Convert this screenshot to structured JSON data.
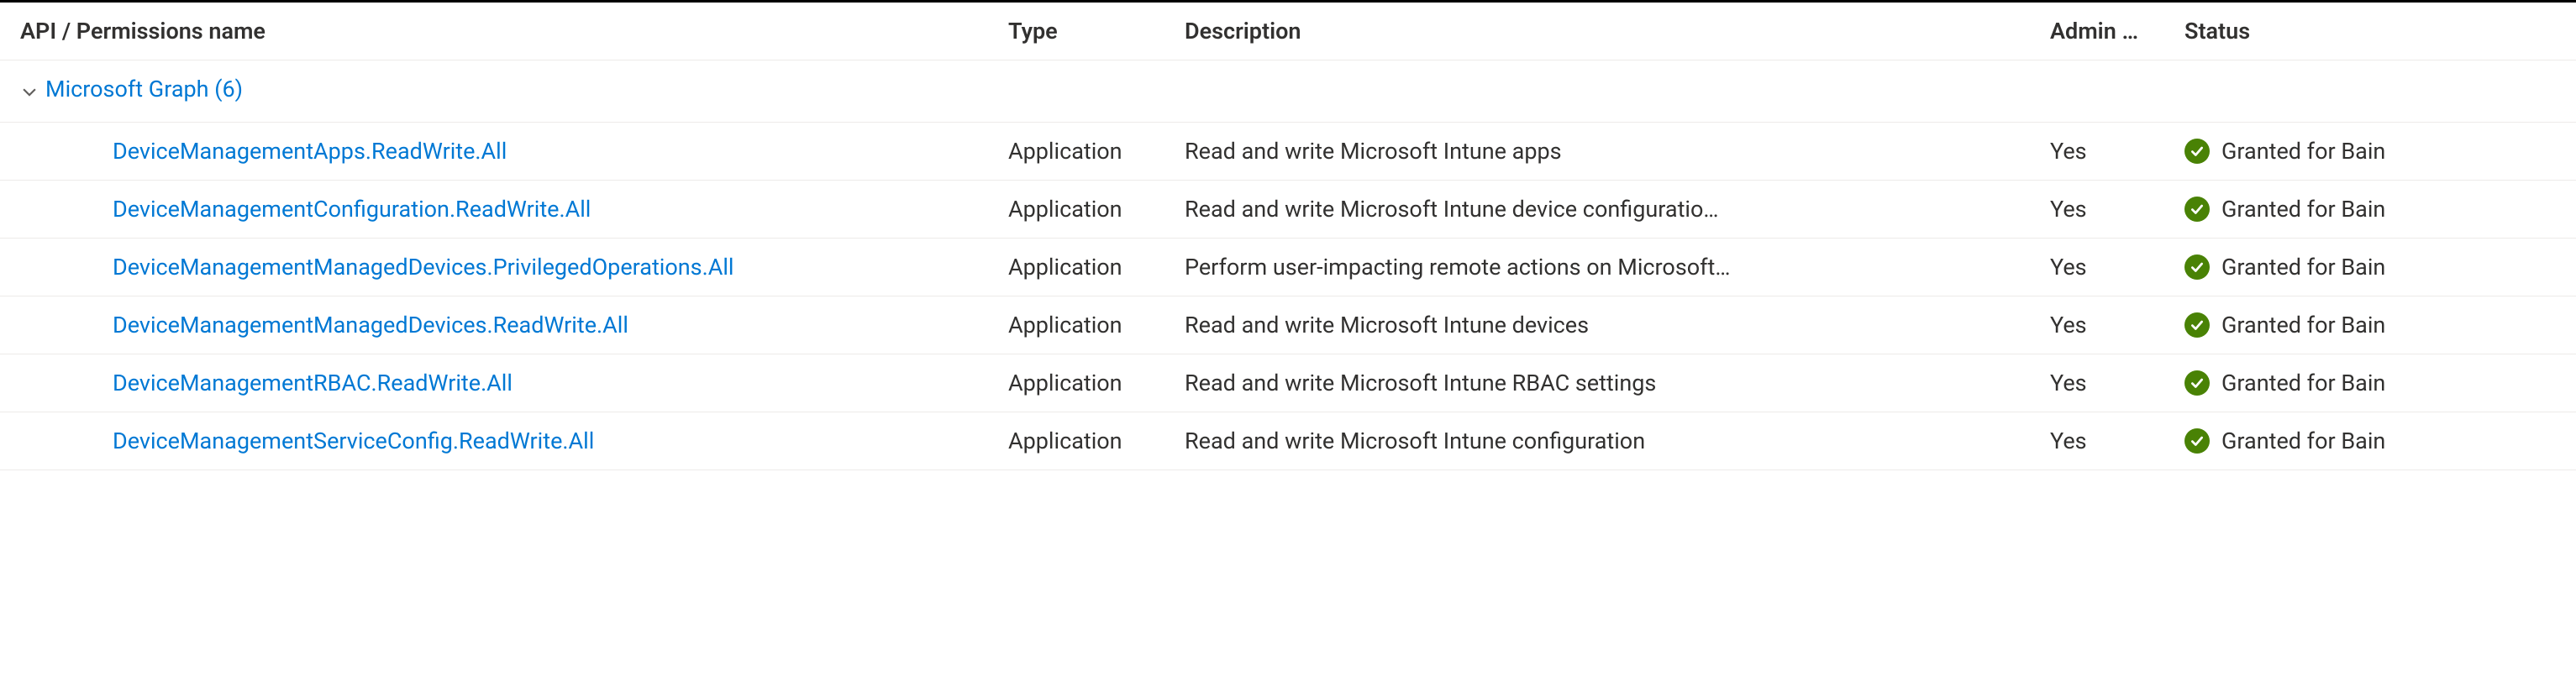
{
  "columns": {
    "name": "API / Permissions name",
    "type": "Type",
    "description": "Description",
    "admin": "Admin …",
    "status": "Status"
  },
  "group": {
    "label": "Microsoft Graph (6)"
  },
  "rows": [
    {
      "name": "DeviceManagementApps.ReadWrite.All",
      "type": "Application",
      "description": "Read and write Microsoft Intune apps",
      "admin": "Yes",
      "status": "Granted for Bain"
    },
    {
      "name": "DeviceManagementConfiguration.ReadWrite.All",
      "type": "Application",
      "description": "Read and write Microsoft Intune device configuratio…",
      "admin": "Yes",
      "status": "Granted for Bain"
    },
    {
      "name": "DeviceManagementManagedDevices.PrivilegedOperations.All",
      "type": "Application",
      "description": "Perform user-impacting remote actions on Microsoft…",
      "admin": "Yes",
      "status": "Granted for Bain"
    },
    {
      "name": "DeviceManagementManagedDevices.ReadWrite.All",
      "type": "Application",
      "description": "Read and write Microsoft Intune devices",
      "admin": "Yes",
      "status": "Granted for Bain"
    },
    {
      "name": "DeviceManagementRBAC.ReadWrite.All",
      "type": "Application",
      "description": "Read and write Microsoft Intune RBAC settings",
      "admin": "Yes",
      "status": "Granted for Bain"
    },
    {
      "name": "DeviceManagementServiceConfig.ReadWrite.All",
      "type": "Application",
      "description": "Read and write Microsoft Intune configuration",
      "admin": "Yes",
      "status": "Granted for Bain"
    }
  ]
}
